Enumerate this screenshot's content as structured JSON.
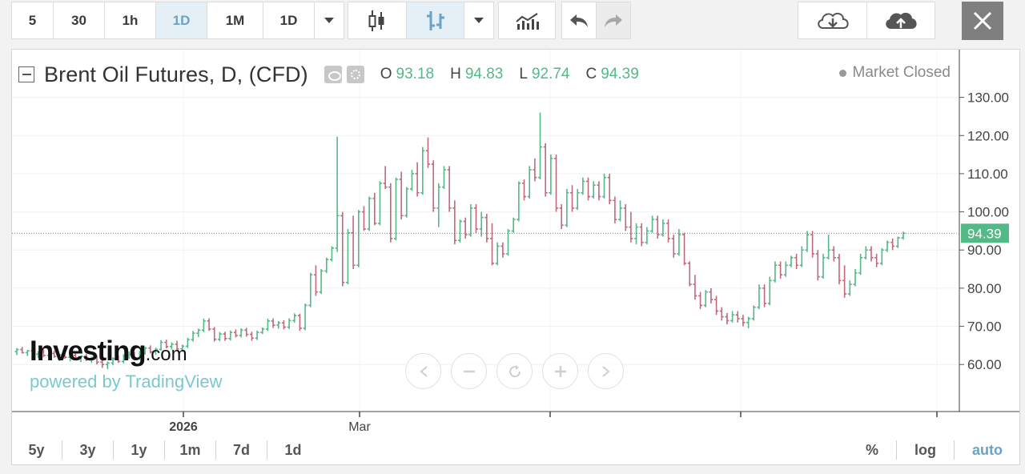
{
  "toolbar": {
    "intervals": [
      "5",
      "30",
      "1h",
      "1D",
      "1M",
      "1D"
    ],
    "active_interval_index": 3
  },
  "legend": {
    "title": "Brent Oil Futures, D, (CFD)",
    "ohlc": [
      {
        "key": "O",
        "value": "93.18"
      },
      {
        "key": "H",
        "value": "94.83"
      },
      {
        "key": "L",
        "value": "92.74"
      },
      {
        "key": "C",
        "value": "94.39"
      }
    ],
    "market_status": "Market Closed"
  },
  "watermark": {
    "brand": "Investing",
    "brand_suffix": ".com",
    "powered_by": "powered by TradingView"
  },
  "ranges": [
    "5y",
    "3y",
    "1y",
    "1m",
    "7d",
    "1d"
  ],
  "scale_options": [
    "%",
    "log",
    "auto"
  ],
  "active_scale_option": "auto",
  "colors": {
    "up": "#53b987",
    "down": "#c2687a",
    "accent": "#6aa3c6",
    "last_price_bg": "#53b987"
  },
  "chart_data": {
    "type": "candlestick",
    "title": "Brent Oil Futures, D, (CFD)",
    "ylim": [
      53,
      136
    ],
    "y_ticks": [
      "130.00",
      "120.00",
      "110.00",
      "100.00",
      "90.00",
      "80.00",
      "70.00",
      "60.00"
    ],
    "x_ticks": [
      "2026",
      "Mar"
    ],
    "last_price": 94.39,
    "last_price_label": "94.39",
    "grid": true,
    "ohlc": [
      [
        63.4,
        64.3,
        62.5,
        63.9
      ],
      [
        63.9,
        64.6,
        62.9,
        63.1
      ],
      [
        63.1,
        63.8,
        62.2,
        63.6
      ],
      [
        63.6,
        64.2,
        62.4,
        62.7
      ],
      [
        62.7,
        63.5,
        61.7,
        63.2
      ],
      [
        63.2,
        63.9,
        61.9,
        62.4
      ],
      [
        62.4,
        63.0,
        61.2,
        62.9
      ],
      [
        62.9,
        63.6,
        61.8,
        62.1
      ],
      [
        62.1,
        62.8,
        60.9,
        62.5
      ],
      [
        62.5,
        63.2,
        61.5,
        61.9
      ],
      [
        61.9,
        62.6,
        60.8,
        62.4
      ],
      [
        62.4,
        63.1,
        61.4,
        61.8
      ],
      [
        61.8,
        62.4,
        60.6,
        62.2
      ],
      [
        62.2,
        62.8,
        60.9,
        61.3
      ],
      [
        61.3,
        62.0,
        60.4,
        61.8
      ],
      [
        61.8,
        62.4,
        60.0,
        60.6
      ],
      [
        60.6,
        61.3,
        59.1,
        60.0
      ],
      [
        60.0,
        60.8,
        58.8,
        60.4
      ],
      [
        60.4,
        61.9,
        59.8,
        61.5
      ],
      [
        61.5,
        62.3,
        60.4,
        60.8
      ],
      [
        60.8,
        62.7,
        60.3,
        62.2
      ],
      [
        62.2,
        63.4,
        61.5,
        62.6
      ],
      [
        62.6,
        63.2,
        61.2,
        61.7
      ],
      [
        61.7,
        63.6,
        61.2,
        63.1
      ],
      [
        63.1,
        64.7,
        62.6,
        64.3
      ],
      [
        64.3,
        65.0,
        62.9,
        63.3
      ],
      [
        63.3,
        64.4,
        62.6,
        64.0
      ],
      [
        64.0,
        66.4,
        63.6,
        65.8
      ],
      [
        65.8,
        66.5,
        64.2,
        64.7
      ],
      [
        64.7,
        65.8,
        63.9,
        65.3
      ],
      [
        65.3,
        66.2,
        63.8,
        64.1
      ],
      [
        64.1,
        65.2,
        63.3,
        64.8
      ],
      [
        64.8,
        67.0,
        64.3,
        66.5
      ],
      [
        66.5,
        68.8,
        66.0,
        68.2
      ],
      [
        68.2,
        69.4,
        67.2,
        69.0
      ],
      [
        69.0,
        72.0,
        68.5,
        71.4
      ],
      [
        71.4,
        72.1,
        68.8,
        69.3
      ],
      [
        69.3,
        69.8,
        66.0,
        66.6
      ],
      [
        66.6,
        68.5,
        66.1,
        68.0
      ],
      [
        68.0,
        68.6,
        66.2,
        66.8
      ],
      [
        66.8,
        68.9,
        66.3,
        68.4
      ],
      [
        68.4,
        69.2,
        67.1,
        67.6
      ],
      [
        67.6,
        69.5,
        67.1,
        69.0
      ],
      [
        69.0,
        69.6,
        67.3,
        67.9
      ],
      [
        67.9,
        68.6,
        66.2,
        66.9
      ],
      [
        66.9,
        68.9,
        66.4,
        68.4
      ],
      [
        68.4,
        69.7,
        68.0,
        69.3
      ],
      [
        69.3,
        72.0,
        68.8,
        71.4
      ],
      [
        71.4,
        72.1,
        69.6,
        70.3
      ],
      [
        70.3,
        71.4,
        69.4,
        70.9
      ],
      [
        70.9,
        71.6,
        69.2,
        69.8
      ],
      [
        69.8,
        72.1,
        69.3,
        71.5
      ],
      [
        71.5,
        73.4,
        71.0,
        72.8
      ],
      [
        72.8,
        73.3,
        68.8,
        69.5
      ],
      [
        69.5,
        76.0,
        69.0,
        75.5
      ],
      [
        75.5,
        84.0,
        75.0,
        83.5
      ],
      [
        83.5,
        86.0,
        78.0,
        79.0
      ],
      [
        79.0,
        85.0,
        78.5,
        84.5
      ],
      [
        84.5,
        88.0,
        84.0,
        87.5
      ],
      [
        87.5,
        91.0,
        87.0,
        90.5
      ],
      [
        90.5,
        119.7,
        89.5,
        99.0
      ],
      [
        99.0,
        100.0,
        80.5,
        81.5
      ],
      [
        81.5,
        95.5,
        81.0,
        94.5
      ],
      [
        94.5,
        99.0,
        85.0,
        86.0
      ],
      [
        86.0,
        100.5,
        85.5,
        100.0
      ],
      [
        100.0,
        101.5,
        95.0,
        95.5
      ],
      [
        95.5,
        104.0,
        95.0,
        103.5
      ],
      [
        103.5,
        105.0,
        96.5,
        97.0
      ],
      [
        97.0,
        108.0,
        96.5,
        107.5
      ],
      [
        107.5,
        112.0,
        106.0,
        106.5
      ],
      [
        106.5,
        107.5,
        92.0,
        93.0
      ],
      [
        93.0,
        109.0,
        92.5,
        108.5
      ],
      [
        108.5,
        110.5,
        98.0,
        99.0
      ],
      [
        99.0,
        106.5,
        98.5,
        106.0
      ],
      [
        106.0,
        111.0,
        105.5,
        110.0
      ],
      [
        110.0,
        113.0,
        104.0,
        105.0
      ],
      [
        105.0,
        117.0,
        104.5,
        116.0
      ],
      [
        116.0,
        119.5,
        111.5,
        112.5
      ],
      [
        112.5,
        113.5,
        100.0,
        101.0
      ],
      [
        101.0,
        107.5,
        96.0,
        106.5
      ],
      [
        106.5,
        112.0,
        106.0,
        111.0
      ],
      [
        111.0,
        112.0,
        100.0,
        101.0
      ],
      [
        101.0,
        103.0,
        91.5,
        92.5
      ],
      [
        92.5,
        98.0,
        92.0,
        97.5
      ],
      [
        97.5,
        98.5,
        93.0,
        94.0
      ],
      [
        94.0,
        102.0,
        93.5,
        101.0
      ],
      [
        101.0,
        102.0,
        94.5,
        95.5
      ],
      [
        95.5,
        100.0,
        93.5,
        98.5
      ],
      [
        98.5,
        99.5,
        92.0,
        93.0
      ],
      [
        93.0,
        97.0,
        86.0,
        86.5
      ],
      [
        86.5,
        92.0,
        86.0,
        91.0
      ],
      [
        91.0,
        92.0,
        88.0,
        89.0
      ],
      [
        89.0,
        95.5,
        88.5,
        95.0
      ],
      [
        95.0,
        98.5,
        94.5,
        98.0
      ],
      [
        98.0,
        108.0,
        97.5,
        107.5
      ],
      [
        107.5,
        108.5,
        103.0,
        104.0
      ],
      [
        104.0,
        112.0,
        103.5,
        111.0
      ],
      [
        111.0,
        114.0,
        108.0,
        109.0
      ],
      [
        109.0,
        126.0,
        108.5,
        117.0
      ],
      [
        117.0,
        118.0,
        104.0,
        105.0
      ],
      [
        105.0,
        115.0,
        104.5,
        114.0
      ],
      [
        114.0,
        115.0,
        100.0,
        101.0
      ],
      [
        101.0,
        102.0,
        95.5,
        96.5
      ],
      [
        96.5,
        106.0,
        96.0,
        105.0
      ],
      [
        105.0,
        107.0,
        100.0,
        101.0
      ],
      [
        101.0,
        106.0,
        100.5,
        105.0
      ],
      [
        105.0,
        109.0,
        104.5,
        108.0
      ],
      [
        108.0,
        109.0,
        103.0,
        104.0
      ],
      [
        104.0,
        108.0,
        103.5,
        107.0
      ],
      [
        107.0,
        108.0,
        103.0,
        104.0
      ],
      [
        104.0,
        110.0,
        103.5,
        109.0
      ],
      [
        109.0,
        110.0,
        102.0,
        103.0
      ],
      [
        103.0,
        104.0,
        97.0,
        98.0
      ],
      [
        98.0,
        103.0,
        97.5,
        101.0
      ],
      [
        101.0,
        102.0,
        95.0,
        96.0
      ],
      [
        96.0,
        100.0,
        92.0,
        93.0
      ],
      [
        93.0,
        97.0,
        91.5,
        96.0
      ],
      [
        96.0,
        97.0,
        91.0,
        92.0
      ],
      [
        92.0,
        96.0,
        91.5,
        95.0
      ],
      [
        95.0,
        99.0,
        94.5,
        98.0
      ],
      [
        98.0,
        99.0,
        93.0,
        94.0
      ],
      [
        94.0,
        98.0,
        93.5,
        97.0
      ],
      [
        97.0,
        98.0,
        92.0,
        93.0
      ],
      [
        93.0,
        94.0,
        88.0,
        89.0
      ],
      [
        89.0,
        95.5,
        88.5,
        94.0
      ],
      [
        94.0,
        94.5,
        86.0,
        86.5
      ],
      [
        86.5,
        87.0,
        80.5,
        81.0
      ],
      [
        81.0,
        83.5,
        77.0,
        78.0
      ],
      [
        78.0,
        79.0,
        74.5,
        75.5
      ],
      [
        75.5,
        79.5,
        75.0,
        79.0
      ],
      [
        79.0,
        80.0,
        76.0,
        77.0
      ],
      [
        77.0,
        78.0,
        73.0,
        74.0
      ],
      [
        74.0,
        75.0,
        71.5,
        72.5
      ],
      [
        72.5,
        73.5,
        70.5,
        71.5
      ],
      [
        71.5,
        74.0,
        71.0,
        73.0
      ],
      [
        73.0,
        74.0,
        71.0,
        72.0
      ],
      [
        72.0,
        73.0,
        70.0,
        71.0
      ],
      [
        71.0,
        72.5,
        69.5,
        72.0
      ],
      [
        72.0,
        75.5,
        71.5,
        75.0
      ],
      [
        75.0,
        81.0,
        74.5,
        80.0
      ],
      [
        80.0,
        81.0,
        75.0,
        76.0
      ],
      [
        76.0,
        83.0,
        75.5,
        82.0
      ],
      [
        82.0,
        87.0,
        81.5,
        86.0
      ],
      [
        86.0,
        87.0,
        82.5,
        83.5
      ],
      [
        83.5,
        87.0,
        83.0,
        86.0
      ],
      [
        86.0,
        88.5,
        85.5,
        88.0
      ],
      [
        88.0,
        89.0,
        85.0,
        86.0
      ],
      [
        86.0,
        91.0,
        85.5,
        90.0
      ],
      [
        90.0,
        95.0,
        89.5,
        94.0
      ],
      [
        94.0,
        95.0,
        88.0,
        89.0
      ],
      [
        89.0,
        90.0,
        82.0,
        83.0
      ],
      [
        83.0,
        89.0,
        82.5,
        88.0
      ],
      [
        88.0,
        94.0,
        87.5,
        90.0
      ],
      [
        90.0,
        91.0,
        87.0,
        88.0
      ],
      [
        88.0,
        89.0,
        81.0,
        82.0
      ],
      [
        82.0,
        86.0,
        77.5,
        78.5
      ],
      [
        78.5,
        82.0,
        78.0,
        81.0
      ],
      [
        81.0,
        85.0,
        80.5,
        84.0
      ],
      [
        84.0,
        89.0,
        83.5,
        88.0
      ],
      [
        88.0,
        91.0,
        87.5,
        90.0
      ],
      [
        90.0,
        91.0,
        87.0,
        88.0
      ],
      [
        88.0,
        89.0,
        85.5,
        86.5
      ],
      [
        86.5,
        90.5,
        86.0,
        90.0
      ],
      [
        90.0,
        92.5,
        89.5,
        92.0
      ],
      [
        92.0,
        93.0,
        90.0,
        91.0
      ],
      [
        91.0,
        93.5,
        90.5,
        93.18
      ],
      [
        93.18,
        94.83,
        92.74,
        94.39
      ]
    ]
  }
}
